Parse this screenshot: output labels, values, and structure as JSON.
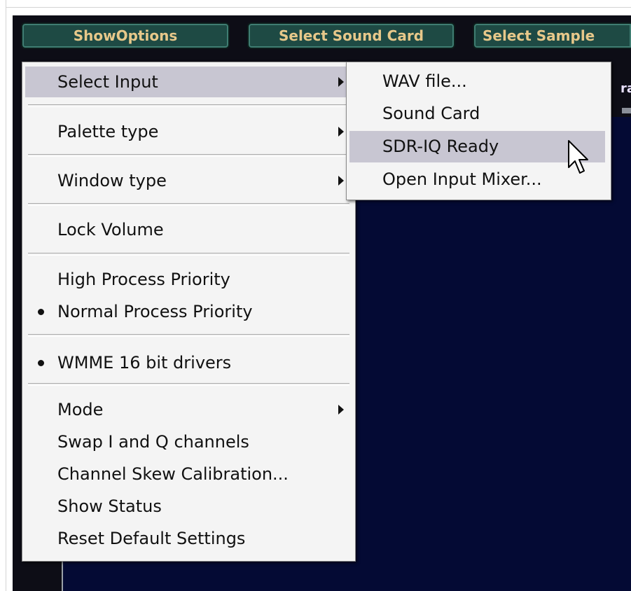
{
  "toolbar": {
    "show_options": "ShowOptions",
    "select_sound_card": "Select Sound Card",
    "select_sample": "Select Sample",
    "peek_text": "ra"
  },
  "menu": {
    "items": [
      {
        "label": "Select Input",
        "submenu": true,
        "highlighted": true
      },
      {
        "label": "Palette type",
        "submenu": true
      },
      {
        "label": "Window type",
        "submenu": true
      },
      {
        "label": "Lock Volume"
      },
      {
        "label": "High Process Priority"
      },
      {
        "label": "Normal Process Priority",
        "checked": true
      },
      {
        "label": "WMME 16 bit drivers",
        "checked": true
      },
      {
        "label": "Mode",
        "submenu": true
      },
      {
        "label": "Swap I and Q channels"
      },
      {
        "label": "Channel Skew Calibration..."
      },
      {
        "label": "Show Status"
      },
      {
        "label": "Reset Default Settings"
      }
    ]
  },
  "submenu": {
    "items": [
      {
        "label": "WAV file..."
      },
      {
        "label": "Sound Card"
      },
      {
        "label": "SDR-IQ Ready",
        "highlighted": true
      },
      {
        "label": "Open Input Mixer..."
      }
    ]
  },
  "colors": {
    "app_background": "#0d0d16",
    "spectrum_background": "#040a34",
    "button_fill": "#1e4a44",
    "button_text": "#e7c88a",
    "menu_background": "#f4f4f4",
    "menu_highlight": "#c8c6d2"
  },
  "icons": {
    "cursor": "mouse-pointer-icon",
    "submenu_arrow": "chevron-right-icon",
    "checked": "bullet-dot-icon"
  }
}
